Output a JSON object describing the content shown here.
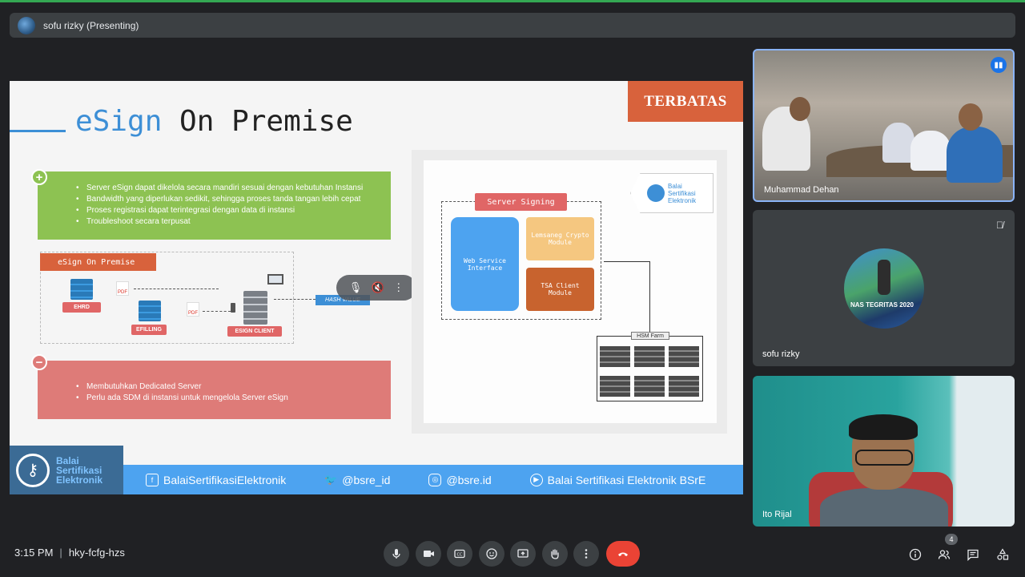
{
  "presenter": {
    "name": "sofu rizky (Presenting)"
  },
  "slide": {
    "title_blue": "eSign",
    "title_rest": " On Premise",
    "badge": "TERBATAS",
    "pros": [
      "Server eSign dapat dikelola secara mandiri sesuai dengan kebutuhan Instansi",
      "Bandwidth yang diperlukan sedikit, sehingga proses tanda tangan lebih  cepat",
      "Proses registrasi dapat terintegrasi dengan data di instansi",
      "Troubleshoot secara terpusat"
    ],
    "cons": [
      "Membutuhkan Dedicated Server",
      "Perlu ada SDM di instansi untuk mengelola Server eSign"
    ],
    "left_diagram": {
      "label": "eSign On Premise",
      "ehrd": "EHRD",
      "efilling": "EFILLING",
      "esign_client": "ESIGN CLIENT",
      "hash": "HASH VALUE",
      "pdf": "PDF"
    },
    "right_diagram": {
      "bsre_tag": [
        "Balai",
        "Sertifikasi",
        "Elektronik"
      ],
      "signing_label": "Server Signing",
      "web_service": "Web Service Interface",
      "crypto": "Lemsaneg Crypto Module",
      "tsa": "TSA Client Module",
      "hsm": "HSM Farm"
    },
    "footer": {
      "logo_text": [
        "Balai",
        "Sertifikasi",
        "Elektronik"
      ],
      "facebook": "BalaiSertifikasiElektronik",
      "twitter": "@bsre_id",
      "instagram": "@bsre.id",
      "youtube": "Balai Sertifikasi Elektronik BSrE"
    }
  },
  "participants": [
    {
      "name": "Muhammad Dehan",
      "speaking": true
    },
    {
      "name": "sofu rizky",
      "muted": true,
      "avatar_text": "NAS TEGRITAS 2020"
    },
    {
      "name": "Ito Rijal"
    }
  ],
  "bottom": {
    "time": "3:15 PM",
    "separator": "|",
    "meeting_code": "hky-fcfg-hzs",
    "people_count": "4"
  },
  "colors": {
    "hangup": "#ea4335",
    "accent": "#8ab4f8",
    "pros": "#8dc252",
    "cons": "#de7b78",
    "slide_blue": "#4da3f0"
  }
}
